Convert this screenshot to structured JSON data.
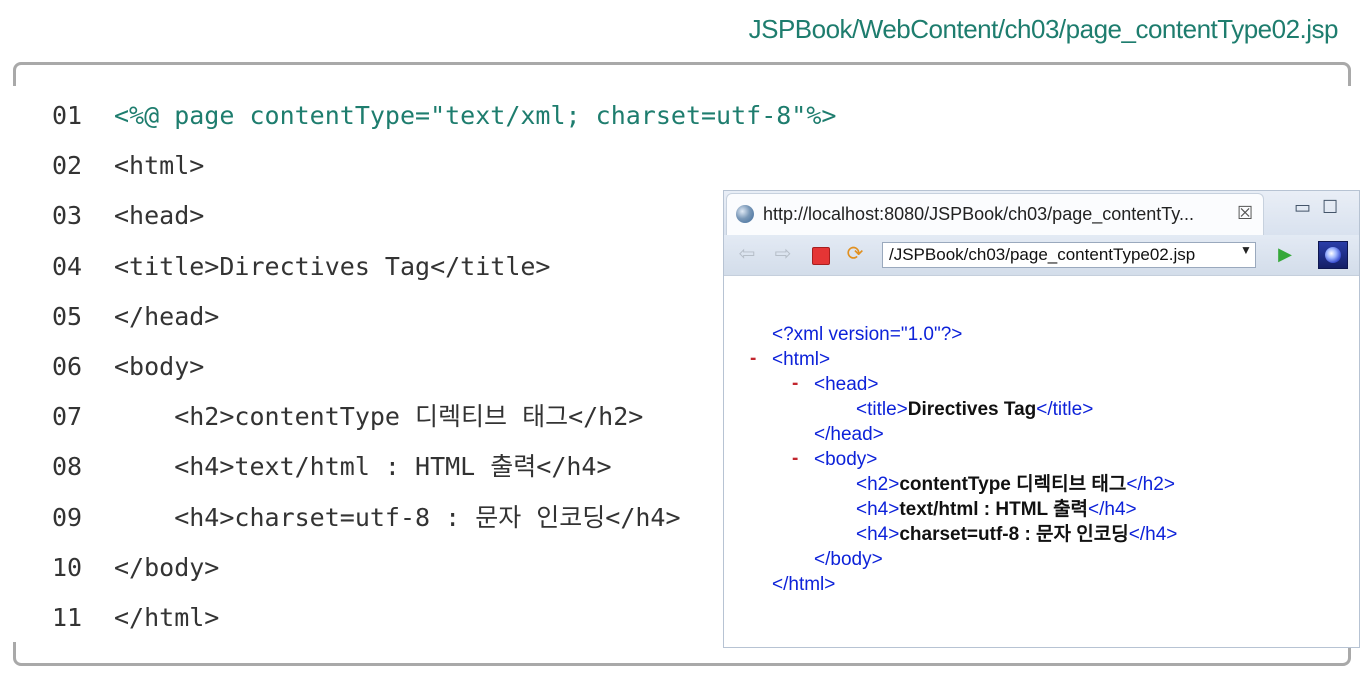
{
  "file_path": "JSPBook/WebContent/ch03/page_contentType02.jsp",
  "code_lines": [
    {
      "num": "01",
      "text": "<%@ page contentType=\"text/xml; charset=utf-8\"%>",
      "teal": true
    },
    {
      "num": "02",
      "text": "<html>"
    },
    {
      "num": "03",
      "text": "<head>"
    },
    {
      "num": "04",
      "text": "<title>Directives Tag</title>"
    },
    {
      "num": "05",
      "text": "</head>"
    },
    {
      "num": "06",
      "text": "<body>"
    },
    {
      "num": "07",
      "text": "    <h2>contentType 디렉티브 태그</h2>"
    },
    {
      "num": "08",
      "text": "    <h4>text/html : HTML 출력</h4>"
    },
    {
      "num": "09",
      "text": "    <h4>charset=utf-8 : 문자 인코딩</h4>"
    },
    {
      "num": "10",
      "text": "</body>"
    },
    {
      "num": "11",
      "text": "</html>"
    }
  ],
  "browser": {
    "tab_title": "http://localhost:8080/JSPBook/ch03/page_contentTy...",
    "close_glyph": "☒",
    "minimize_glyph": "▭",
    "maximize_glyph": "☐",
    "url": "/JSPBook/ch03/page_contentType02.jsp",
    "icons": {
      "back": "⇦",
      "forward": "⇨",
      "refresh": "⟳",
      "go": "▶",
      "dropdown": "▼"
    },
    "xml": {
      "decl": "<?xml version=\"1.0\"?>",
      "minus": "-",
      "html_open": "<html>",
      "head_open": "<head>",
      "title_open": "<title>",
      "title_text": "Directives Tag",
      "title_close": "</title>",
      "head_close": "</head>",
      "body_open": "<body>",
      "h2_open": "<h2>",
      "h2_text": "contentType 디렉티브 태그",
      "h2_close": "</h2>",
      "h4_open": "<h4>",
      "h4a_text": "text/html : HTML 출력",
      "h4b_text": "charset=utf-8 : 문자 인코딩",
      "h4_close": "</h4>",
      "body_close": "</body>",
      "html_close": "</html>"
    }
  }
}
